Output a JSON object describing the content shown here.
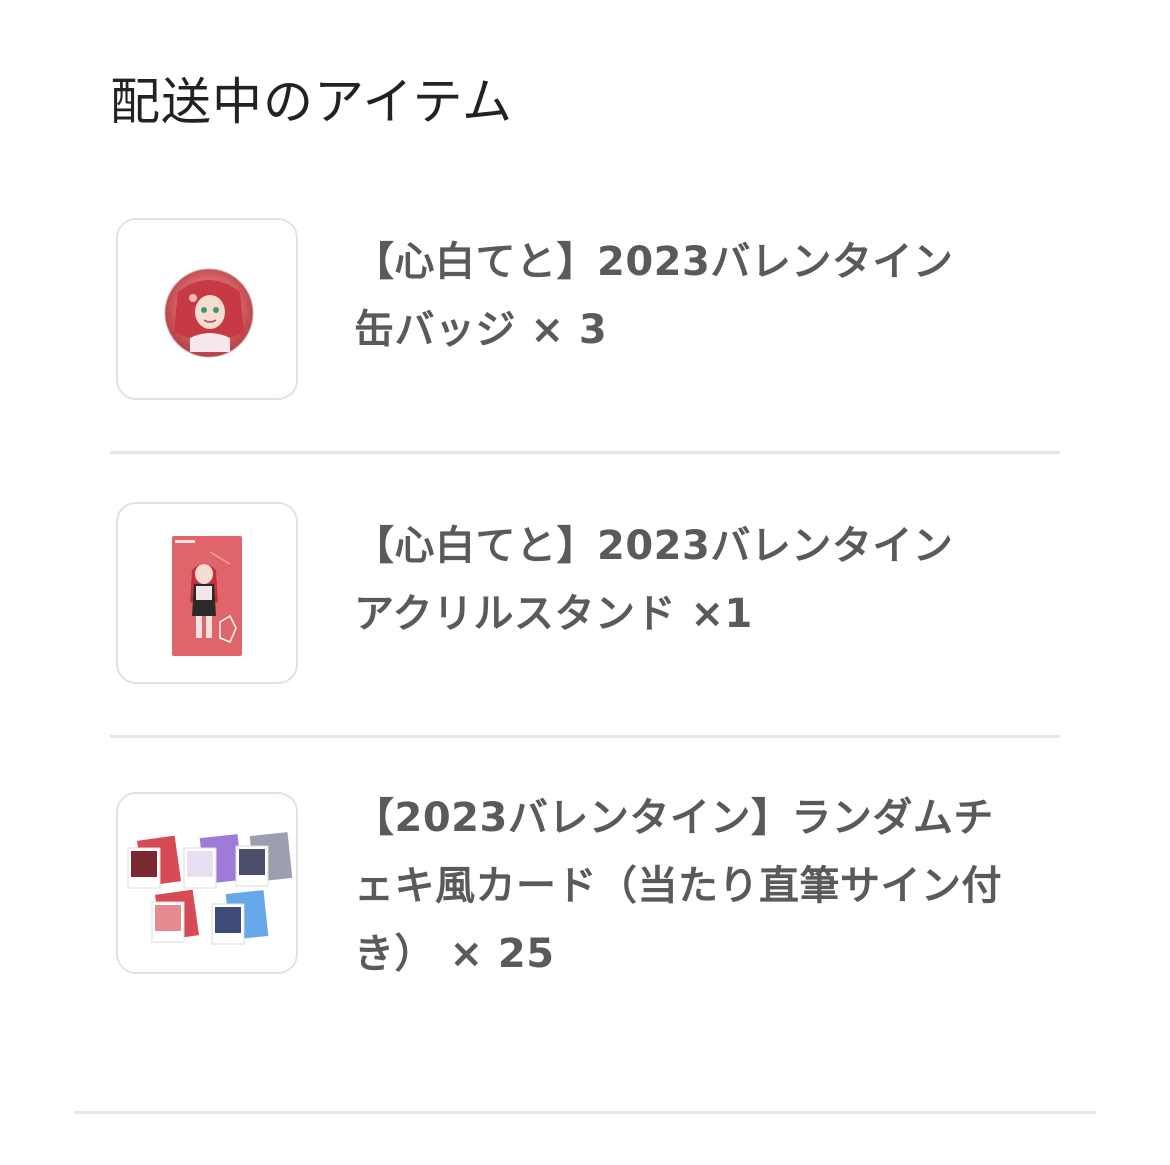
{
  "section": {
    "title": "配送中のアイテム"
  },
  "items": [
    {
      "name": "【心白てと】2023バレンタイン　缶バッジ",
      "quantity_label": "× 3",
      "thumbnail_icon": "can-badge-image"
    },
    {
      "name": "【心白てと】2023バレンタイン　アクリルスタンド",
      "quantity_label": "×1",
      "thumbnail_icon": "acrylic-stand-image"
    },
    {
      "name": "【2023バレンタイン】ランダムチェキ風カード（当たり直筆サイン付き）",
      "quantity_label": "× 25",
      "thumbnail_icon": "cheki-cards-image"
    }
  ],
  "colors": {
    "title_text": "#222222",
    "item_text": "#5a5a5a",
    "divider": "#e6e6e6",
    "thumb_border": "#e2e2e2",
    "accent_red": "#d9595f"
  }
}
